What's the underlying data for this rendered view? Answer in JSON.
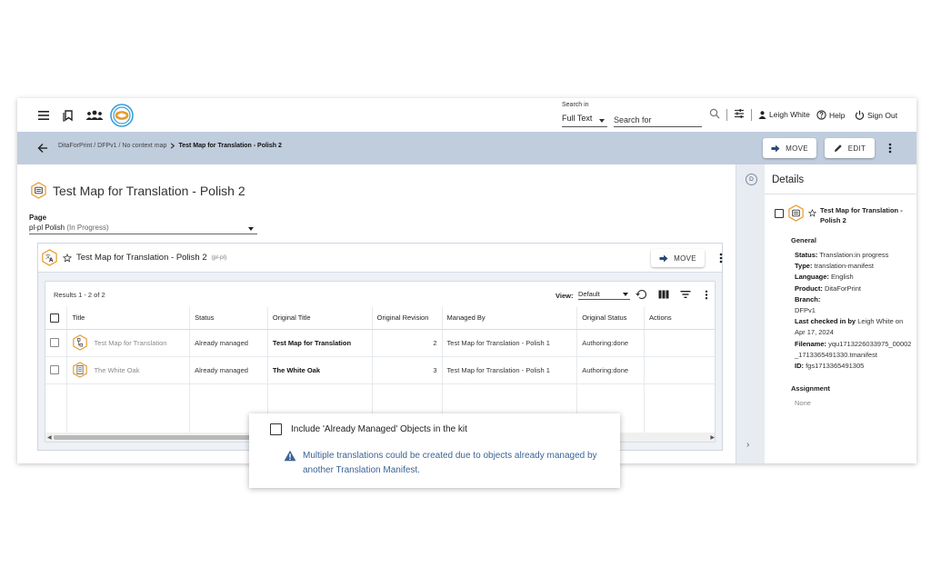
{
  "topbar": {
    "search_in_label": "Search in",
    "search_scope": "Full Text",
    "search_placeholder": "Search for",
    "user_name": "Leigh White",
    "help_label": "Help",
    "signout_label": "Sign Out"
  },
  "breadcrumb": {
    "path": "DitaForPrint / DFPv1 / No context map",
    "current": "Test Map for Translation - Polish 2",
    "move_label": "MOVE",
    "edit_label": "EDIT"
  },
  "main": {
    "page_title": "Test Map for Translation - Polish 2",
    "page_label": "Page",
    "page_value": "pl-pl Polish",
    "page_status": "(In Progress)",
    "panel": {
      "title": "Test Map for Translation - Polish 2",
      "lang": "(pl-pl)",
      "move_label": "MOVE"
    },
    "grid": {
      "results": "Results 1 - 2 of 2",
      "view_label": "View:",
      "view_value": "Default",
      "columns": [
        "Title",
        "Status",
        "Original Title",
        "Original Revision",
        "Managed By",
        "Original Status",
        "Actions"
      ],
      "rows": [
        {
          "title": "Test Map for Translation",
          "status": "Already managed",
          "original_title": "Test Map for Translation",
          "revision": "2",
          "managed_by": "Test Map for Translation - Polish 1",
          "original_status": "Authoring:done",
          "icon": "map-icon"
        },
        {
          "title": "The White Oak",
          "status": "Already managed",
          "original_title": "The White Oak",
          "revision": "3",
          "managed_by": "Test Map for Translation - Polish 1",
          "original_status": "Authoring:done",
          "icon": "topic-icon"
        }
      ]
    }
  },
  "details": {
    "rail_badge": "D",
    "title": "Details",
    "object_title": "Test Map for Translation - Polish 2",
    "general_label": "General",
    "props": {
      "status_label": "Status:",
      "status_value": "Translation:in progress",
      "type_label": "Type:",
      "type_value": "translation-manifest",
      "language_label": "Language:",
      "language_value": "English",
      "product_label": "Product:",
      "product_value": "DitaForPrint",
      "branch_label": "Branch:",
      "branch_value": "DFPv1",
      "checked_label": "Last checked in by",
      "checked_value": "Leigh White on Apr 17, 2024",
      "filename_label": "Filename:",
      "filename_value": "yqu1713226033975_00002_1713365491330.tmanifest",
      "id_label": "ID:",
      "id_value": "fgs1713365491305"
    },
    "assignment_label": "Assignment",
    "assignment_value": "None"
  },
  "popup": {
    "checkbox_label": "Include 'Already Managed' Objects in the kit",
    "warning": "Multiple translations could be created due to objects already managed by another Translation Manifest."
  },
  "colors": {
    "accent": "#3b6496",
    "crumb_bar": "#bfcddd",
    "icon_orange": "#e89a2c"
  }
}
